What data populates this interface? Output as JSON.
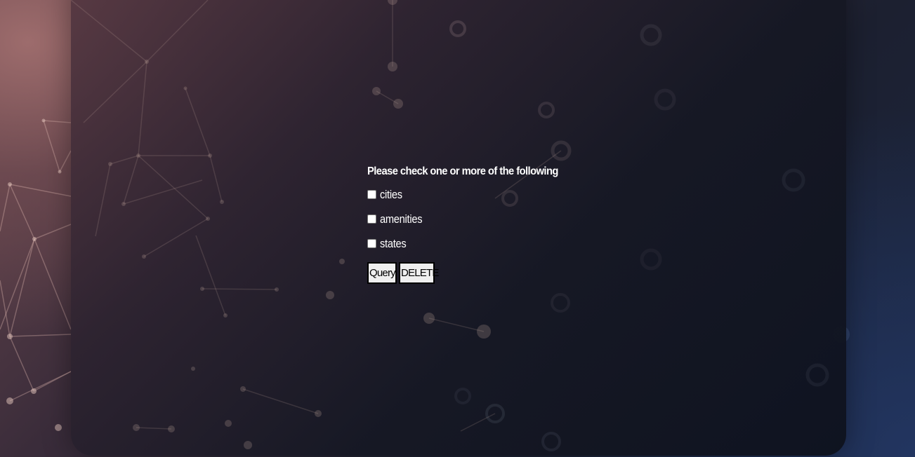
{
  "form": {
    "title": "Please check one or more of the following",
    "options": [
      {
        "label": "cities",
        "checked": false
      },
      {
        "label": "amenities",
        "checked": false
      },
      {
        "label": "states",
        "checked": false
      }
    ],
    "buttons": {
      "query_label": "Query",
      "delete_label": "DELETE"
    }
  },
  "colors": {
    "text": "#ffffff",
    "button_bg": "#efefef",
    "button_border": "#000000"
  }
}
